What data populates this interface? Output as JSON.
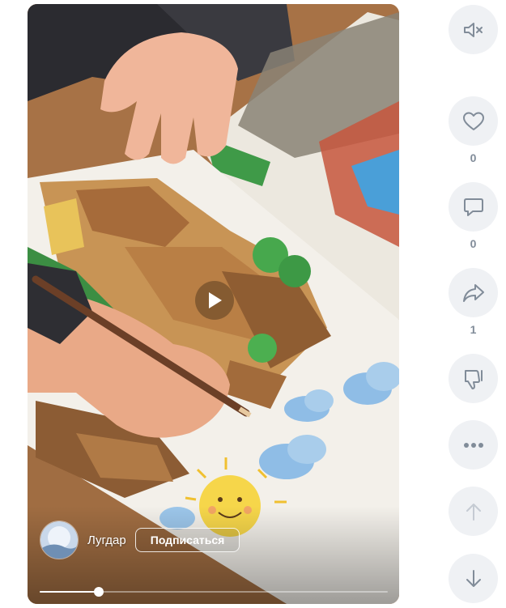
{
  "video": {
    "author_name": "Лугдар",
    "subscribe_label": "Подписаться",
    "progress_fraction": 0.17
  },
  "actions": {
    "likes_count": "0",
    "comments_count": "0",
    "shares_count": "1"
  },
  "colors": {
    "icon": "#818c99",
    "button_bg": "#eff1f4",
    "disabled_icon": "#c5cbd3"
  },
  "icons": [
    "mute-icon",
    "heart-icon",
    "comment-icon",
    "share-icon",
    "dislike-icon",
    "more-icon",
    "arrow-up-icon",
    "arrow-down-icon",
    "play-icon"
  ]
}
